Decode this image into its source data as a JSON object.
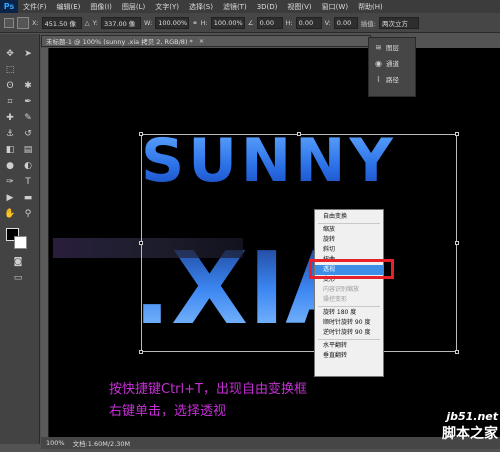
{
  "menubar": {
    "logo": "Ps",
    "items": [
      "文件(F)",
      "编辑(E)",
      "图像(I)",
      "图层(L)",
      "文字(Y)",
      "选择(S)",
      "滤镜(T)",
      "3D(D)",
      "视图(V)",
      "窗口(W)",
      "帮助(H)"
    ]
  },
  "options": {
    "x_label": "X:",
    "x_value": "451.50 像",
    "y_label": "Y:",
    "y_value": "337.00 像",
    "w_label": "W:",
    "w_value": "100.00%",
    "h_label": "H:",
    "h_value": "100.00%",
    "angle_value": "0.00",
    "hskew_label": "H:",
    "hskew_value": "0.00",
    "vskew_label": "V:",
    "vskew_value": "0.00",
    "interp_label": "插值:",
    "interp_value": "两次立方"
  },
  "document": {
    "tab_title": "未标题-1 @ 100% (sunny .xia 拷贝 2, RGB/8) *",
    "close": "×"
  },
  "panel": {
    "items": [
      {
        "icon": "layers-icon",
        "label": "图层"
      },
      {
        "icon": "channels-icon",
        "label": "通道"
      },
      {
        "icon": "paths-icon",
        "label": "路径"
      }
    ]
  },
  "artwork": {
    "line1": "SUNNY",
    "line2": ".XIA"
  },
  "context_menu": {
    "items": [
      {
        "label": "自由变换",
        "state": "normal"
      },
      {
        "sep": true
      },
      {
        "label": "缩放",
        "state": "normal"
      },
      {
        "label": "旋转",
        "state": "normal"
      },
      {
        "label": "斜切",
        "state": "normal"
      },
      {
        "label": "扭曲",
        "state": "normal"
      },
      {
        "label": "透视",
        "state": "selected"
      },
      {
        "label": "变形",
        "state": "normal"
      },
      {
        "label": "内容识别缩放",
        "state": "disabled"
      },
      {
        "label": "操控变形",
        "state": "disabled"
      },
      {
        "sep": true
      },
      {
        "label": "旋转 180 度",
        "state": "normal"
      },
      {
        "label": "顺时针旋转 90 度",
        "state": "normal"
      },
      {
        "label": "逆时针旋转 90 度",
        "state": "normal"
      },
      {
        "sep": true
      },
      {
        "label": "水平翻转",
        "state": "normal"
      },
      {
        "label": "垂直翻转",
        "state": "normal"
      }
    ]
  },
  "instructions": {
    "line1": "按快捷键Ctrl+T，出现自由变换框",
    "line2": "右键单击，选择透视"
  },
  "status": {
    "zoom": "100%",
    "doc": "文档:1.60M/2.30M"
  },
  "watermark": {
    "site": "jb51.net",
    "name": "脚本之家"
  },
  "colors": {
    "highlight_box": "#e8202a",
    "instruction_text": "#c62fd6",
    "menu_selected": "#3d8ee6"
  }
}
